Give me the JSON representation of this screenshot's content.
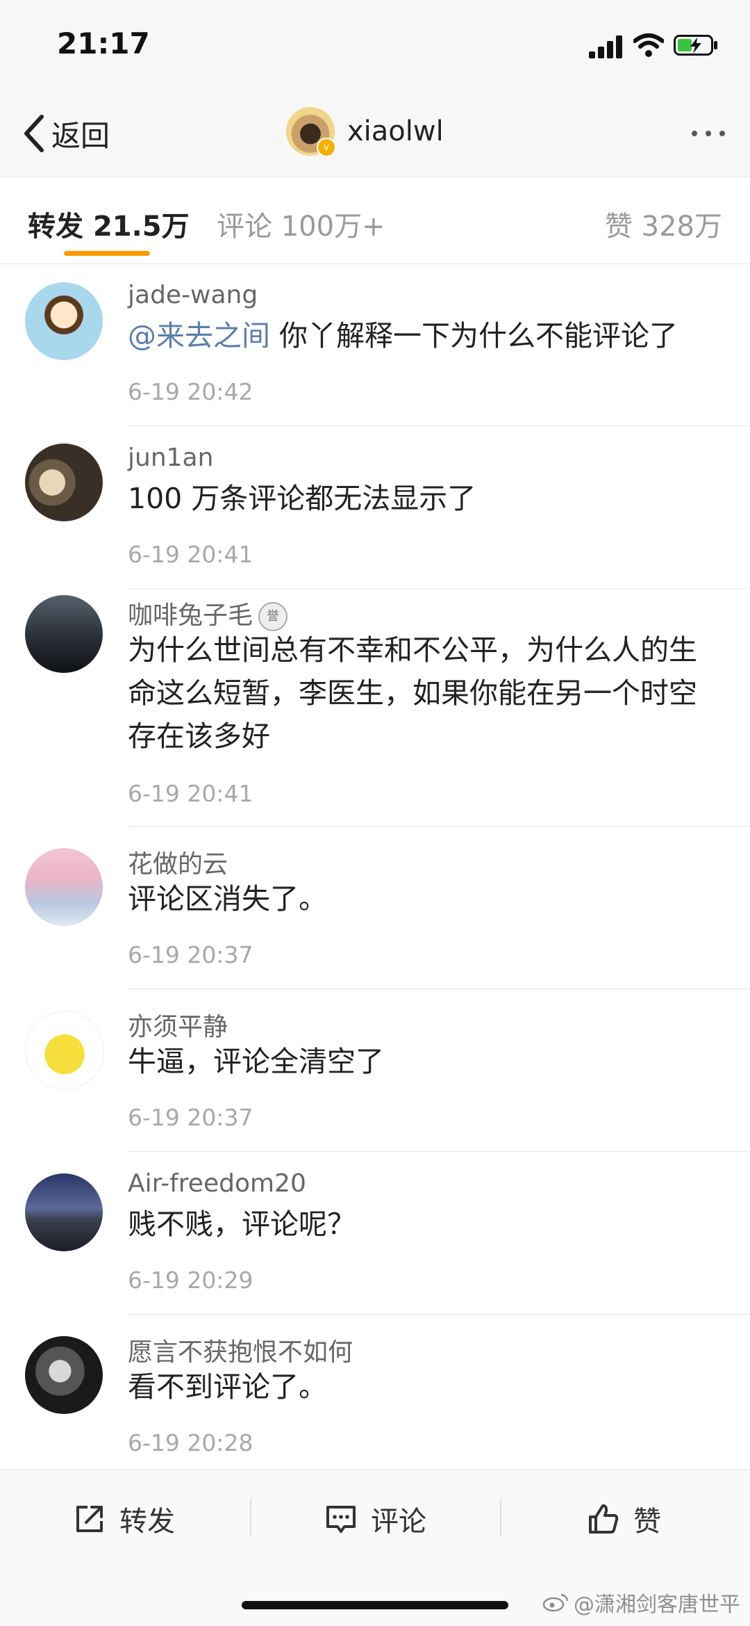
{
  "status_bar": {
    "time": "21:17"
  },
  "nav": {
    "back_label": "返回",
    "username": "xiaolwl",
    "verified_mark": "v"
  },
  "tabs": {
    "repost_label": "转发",
    "repost_count": "21.5万",
    "comment_label": "评论",
    "comment_count": "100万+",
    "like_label": "赞",
    "like_count": "328万"
  },
  "comments": [
    {
      "user": "jade-wang",
      "mention": "@来去之间",
      "text": " 你丫解释一下为什么不能评论了",
      "time": "6-19 20:42"
    },
    {
      "user": "jun1an",
      "text": "100 万条评论都无法显示了",
      "time": "6-19 20:41"
    },
    {
      "user": "咖啡兔子毛",
      "medal": "誉",
      "text": "为什么世间总有不幸和不公平，为什么人的生命这么短暂，李医生，如果你能在另一个时空存在该多好",
      "time": "6-19 20:41"
    },
    {
      "user": "花做的云",
      "text": "评论区消失了。",
      "time": "6-19 20:37"
    },
    {
      "user": "亦须平静",
      "text": "牛逼，评论全清空了",
      "time": "6-19 20:37"
    },
    {
      "user": "Air-freedom20",
      "text": "贱不贱，评论呢？",
      "time": "6-19 20:29"
    },
    {
      "user": "愿言不获抱恨不如何",
      "text": "看不到评论了。",
      "time": "6-19 20:28"
    }
  ],
  "toolbar": {
    "repost": "转发",
    "comment": "评论",
    "like": "赞"
  },
  "watermark": "@潇湘剑客唐世平",
  "colors": {
    "accent": "#ff9a00",
    "mention": "#5a7fab",
    "verified": "#f5b000"
  }
}
